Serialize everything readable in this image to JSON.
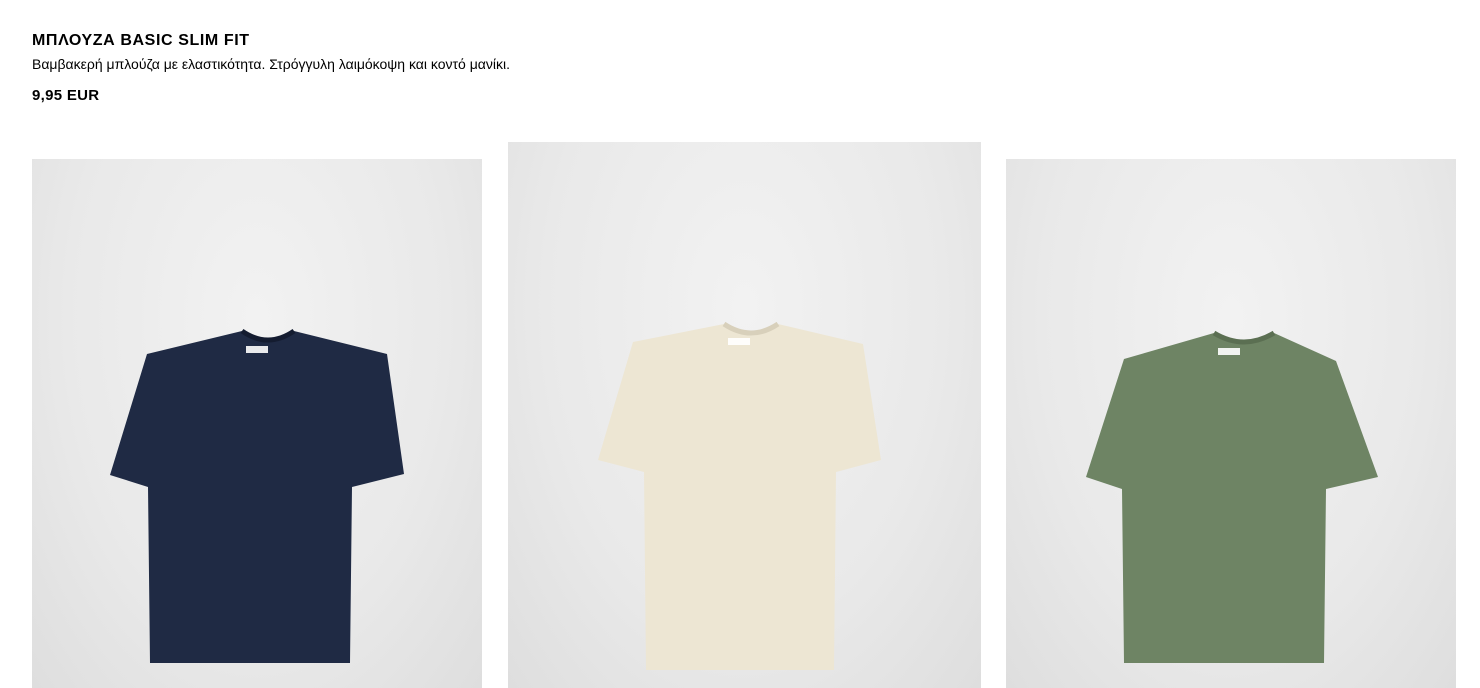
{
  "product": {
    "title": "ΜΠΛΟΥΖΑ BASIC SLIM FIT",
    "description": "Βαμβακερή μπλούζα με ελαστικότητα. Στρόγγυλη λαιμόκοψη και κοντό μανίκι.",
    "price": "9,95 EUR"
  },
  "images": [
    {
      "name": "navy",
      "color": "#1f2a44",
      "shade": "#141c30"
    },
    {
      "name": "ecru",
      "color": "#ede6d3",
      "shade": "#d8d0bb"
    },
    {
      "name": "khaki-green",
      "color": "#6e8464",
      "shade": "#5b6f52"
    }
  ]
}
